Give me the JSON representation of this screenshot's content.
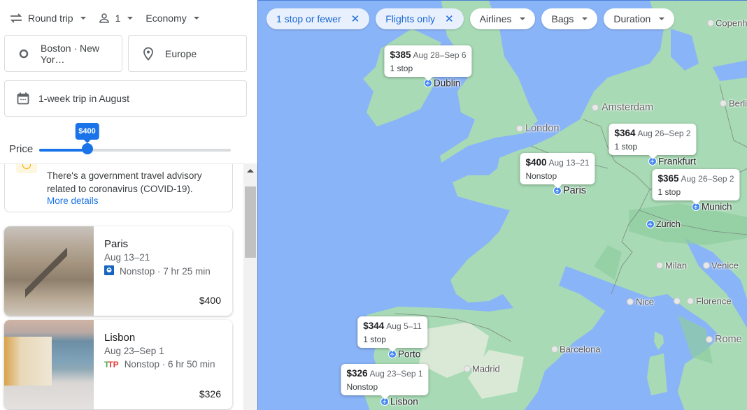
{
  "search": {
    "trip_type": "Round trip",
    "passengers": "1",
    "cabin_class": "Economy",
    "origin": "Boston · New Yor…",
    "destination": "Europe",
    "dates": "1-week trip in August",
    "price_label": "Price",
    "price_max": "$400",
    "price_slider_fraction": 0.25
  },
  "advisory": {
    "text": "There's a government travel advisory related to coronavirus (COVID-19).",
    "link": "More details"
  },
  "results": [
    {
      "city": "Paris",
      "dates": "Aug 13–21",
      "flight": "Nonstop · 7 hr 25 min",
      "airline_icon": "air-france-logo",
      "price": "$400"
    },
    {
      "city": "Lisbon",
      "dates": "Aug 23–Sep 1",
      "flight": "Nonstop · 6 hr 50 min",
      "airline_icon": "tap-portugal-logo",
      "airline_mark": "TP",
      "price": "$326"
    }
  ],
  "filters": [
    {
      "label": "1 stop or fewer",
      "active": true
    },
    {
      "label": "Flights only",
      "active": true
    },
    {
      "label": "Airlines",
      "active": false
    },
    {
      "label": "Bags",
      "active": false
    },
    {
      "label": "Duration",
      "active": false
    }
  ],
  "map": {
    "destinations": [
      {
        "city": "Dublin",
        "price": "$385",
        "dates": "Aug 28–Sep 6",
        "stops": "1 stop"
      },
      {
        "city": "Paris",
        "price": "$400",
        "dates": "Aug 13–21",
        "stops": "Nonstop"
      },
      {
        "city": "Frankfurt",
        "price": "$364",
        "dates": "Aug 26–Sep 2",
        "stops": "1 stop"
      },
      {
        "city": "Munich",
        "price": "$365",
        "dates": "Aug 26–Sep 2",
        "stops": "1 stop"
      },
      {
        "city": "Porto",
        "price": "$344",
        "dates": "Aug 5–11",
        "stops": "1 stop"
      },
      {
        "city": "Lisbon",
        "price": "$326",
        "dates": "Aug 23–Sep 1",
        "stops": "Nonstop"
      }
    ],
    "airport_labels": [
      "Zürich"
    ],
    "city_labels": [
      "Amsterdam",
      "London",
      "Berlin",
      "Copenhagen",
      "Milan",
      "Venice",
      "Nice",
      "Florence",
      "Rome",
      "Barcelona",
      "Madrid"
    ],
    "colors": {
      "water": "#8ab4f8",
      "land": "#a8dab5",
      "accent": "#1a73e8"
    }
  }
}
